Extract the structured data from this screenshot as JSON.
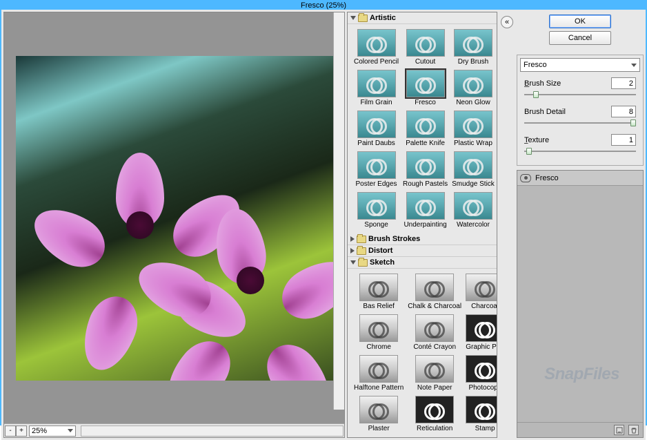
{
  "window": {
    "title": "Fresco (25%)"
  },
  "buttons": {
    "ok": "OK",
    "cancel": "Cancel"
  },
  "zoom": {
    "level": "25%",
    "minus": "-",
    "plus": "+"
  },
  "filterSelect": {
    "value": "Fresco"
  },
  "params": [
    {
      "label": "Brush Size",
      "underline": "B",
      "value": "2",
      "pos": 8
    },
    {
      "label": "Brush Detail",
      "underline": "",
      "value": "8",
      "pos": 95
    },
    {
      "label": "Texture",
      "underline": "T",
      "value": "1",
      "pos": 2
    }
  ],
  "categories": {
    "artistic": {
      "label": "Artistic",
      "open": true,
      "items": [
        "Colored Pencil",
        "Cutout",
        "Dry Brush",
        "Film Grain",
        "Fresco",
        "Neon Glow",
        "Paint Daubs",
        "Palette Knife",
        "Plastic Wrap",
        "Poster Edges",
        "Rough Pastels",
        "Smudge Stick",
        "Sponge",
        "Underpainting",
        "Watercolor"
      ],
      "selected": "Fresco"
    },
    "brushStrokes": {
      "label": "Brush Strokes",
      "open": false
    },
    "distort": {
      "label": "Distort",
      "open": false
    },
    "sketch": {
      "label": "Sketch",
      "open": true,
      "items": [
        "Bas Relief",
        "Chalk & Charcoal",
        "Charcoal",
        "Chrome",
        "Conté Crayon",
        "Graphic Pen",
        "Halftone Pattern",
        "Note Paper",
        "Photocopy",
        "Plaster",
        "Reticulation",
        "Stamp"
      ]
    }
  },
  "layers": {
    "current": "Fresco"
  },
  "collapse": {
    "glyph": "«"
  },
  "watermark": "SnapFiles"
}
